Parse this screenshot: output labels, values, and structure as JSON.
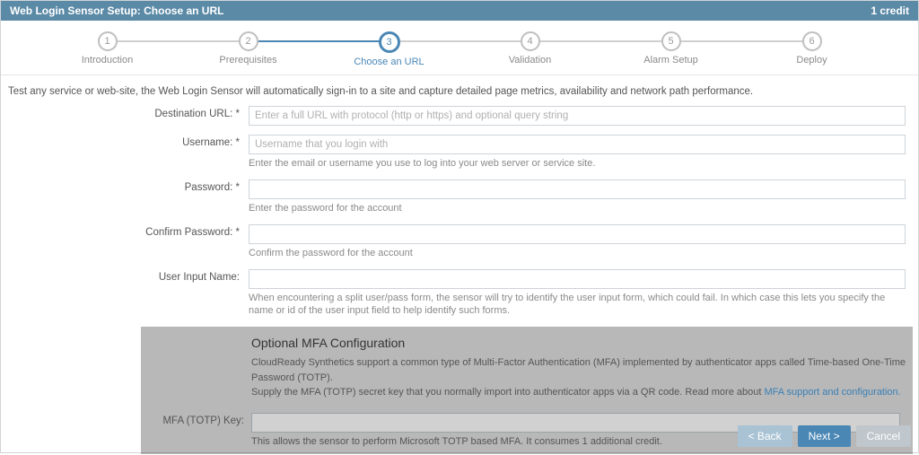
{
  "header": {
    "title": "Web Login Sensor Setup: Choose an URL",
    "credits": "1 credit"
  },
  "stepper": {
    "steps": [
      {
        "num": "1",
        "label": "Introduction"
      },
      {
        "num": "2",
        "label": "Prerequisites"
      },
      {
        "num": "3",
        "label": "Choose an URL"
      },
      {
        "num": "4",
        "label": "Validation"
      },
      {
        "num": "5",
        "label": "Alarm Setup"
      },
      {
        "num": "6",
        "label": "Deploy"
      }
    ],
    "active_index": 2
  },
  "intro": "Test any service or web-site, the Web Login Sensor will automatically sign-in to a site and capture detailed page metrics, availability and network path performance.",
  "form": {
    "dest_url": {
      "label": "Destination URL:",
      "required": "*",
      "value": "",
      "placeholder": "Enter a full URL with protocol (http or https) and optional query string"
    },
    "username": {
      "label": "Username:",
      "required": "*",
      "value": "",
      "placeholder": "Username that you login with",
      "help": "Enter the email or username you use to log into your web server or service site."
    },
    "password": {
      "label": "Password:",
      "required": "*",
      "value": "",
      "help": "Enter the password for the account"
    },
    "confirm": {
      "label": "Confirm Password:",
      "required": "*",
      "value": "",
      "help": "Confirm the password for the account"
    },
    "user_input_name": {
      "label": "User Input Name:",
      "value": "",
      "help": "When encountering a split user/pass form, the sensor will try to identify the user input form, which could fail. In which case this lets you specify the name or id of the user input field to help identify such forms."
    }
  },
  "mfa": {
    "title": "Optional MFA Configuration",
    "line1": "CloudReady Synthetics support a common type of Multi-Factor Authentication (MFA) implemented by authenticator apps called Time-based One-Time Password (TOTP).",
    "line2_a": "Supply the MFA (TOTP) secret key that you normally import into authenticator apps via a QR code. Read more about ",
    "line2_link": "MFA support and configuration.",
    "key": {
      "label": "MFA (TOTP) Key:",
      "value": "",
      "help": "This allows the sensor to perform Microsoft TOTP based MFA. It consumes 1 additional credit."
    }
  },
  "footer": {
    "back": "< Back",
    "next": "Next >",
    "cancel": "Cancel"
  }
}
